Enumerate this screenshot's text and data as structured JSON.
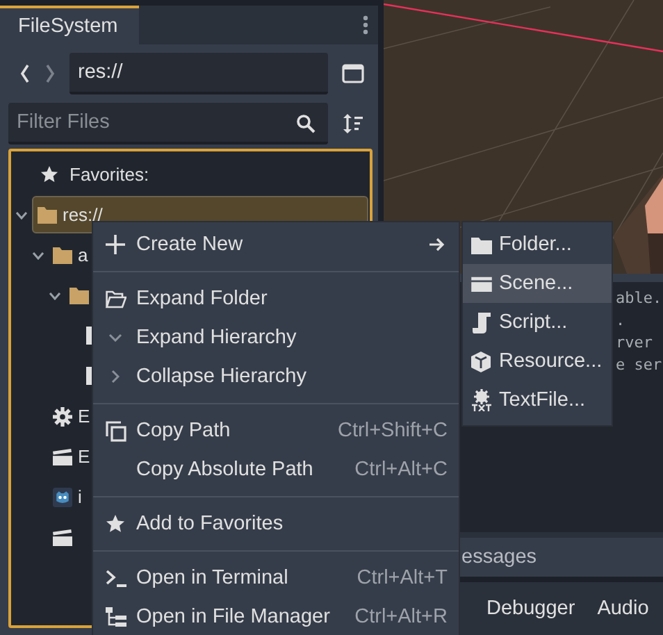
{
  "dock": {
    "tab": {
      "label": "FileSystem",
      "selected": true
    },
    "path": {
      "value": "res://"
    },
    "filter": {
      "placeholder": "Filter Files"
    },
    "tree": {
      "favorites_label": "Favorites:",
      "items": [
        {
          "name": "res://",
          "kind": "folder",
          "expanded": true,
          "selected": true,
          "children": [
            {
              "name": "a",
              "kind": "folder",
              "expanded": true,
              "selected": false,
              "children": [
                {
                  "kind": "folder",
                  "expanded": true,
                  "selected": false,
                  "children": [
                    {
                      "kind": "file",
                      "selected": false
                    },
                    {
                      "kind": "file",
                      "selected": false
                    }
                  ]
                }
              ]
            },
            {
              "name": "E",
              "kind": "gear",
              "selected": false
            },
            {
              "name": "E",
              "kind": "scene",
              "selected": false
            },
            {
              "name": "i",
              "kind": "godot",
              "selected": false
            },
            {
              "kind": "scene",
              "selected": false
            }
          ]
        }
      ]
    }
  },
  "output": {
    "lines": [
      "able.",
      ".",
      "rver",
      "e ser"
    ],
    "filter_label": "essages"
  },
  "bottom_tabs": [
    {
      "label": "Debugger"
    },
    {
      "label": "Audio"
    }
  ],
  "context_menu": {
    "groups": [
      [
        {
          "label": "Create New",
          "kind": "plus",
          "submenu": true
        }
      ],
      [
        {
          "label": "Expand Folder",
          "kind": "folder-open",
          "submenu": false
        },
        {
          "label": "Expand Hierarchy",
          "kind": "chevron-down",
          "submenu": false
        },
        {
          "label": "Collapse Hierarchy",
          "kind": "chevron-right",
          "submenu": false
        }
      ],
      [
        {
          "label": "Copy Path",
          "kind": "copy",
          "shortcut": "Ctrl+Shift+C",
          "submenu": false
        },
        {
          "label": "Copy Absolute Path",
          "kind": "plain",
          "shortcut": "Ctrl+Alt+C",
          "submenu": false
        }
      ],
      [
        {
          "label": "Add to Favorites",
          "kind": "star",
          "submenu": false
        }
      ],
      [
        {
          "label": "Open in Terminal",
          "kind": "terminal",
          "shortcut": "Ctrl+Alt+T",
          "submenu": false
        },
        {
          "label": "Open in File Manager",
          "kind": "tree",
          "shortcut": "Ctrl+Alt+R",
          "submenu": false
        }
      ]
    ]
  },
  "submenu": {
    "items": [
      {
        "label": "Folder...",
        "kind": "folder",
        "selected": false
      },
      {
        "label": "Scene...",
        "kind": "scene",
        "selected": true
      },
      {
        "label": "Script...",
        "kind": "script",
        "selected": false
      },
      {
        "label": "Resource...",
        "kind": "cube",
        "selected": false
      },
      {
        "label": "TextFile...",
        "kind": "text",
        "selected": false
      }
    ]
  }
}
